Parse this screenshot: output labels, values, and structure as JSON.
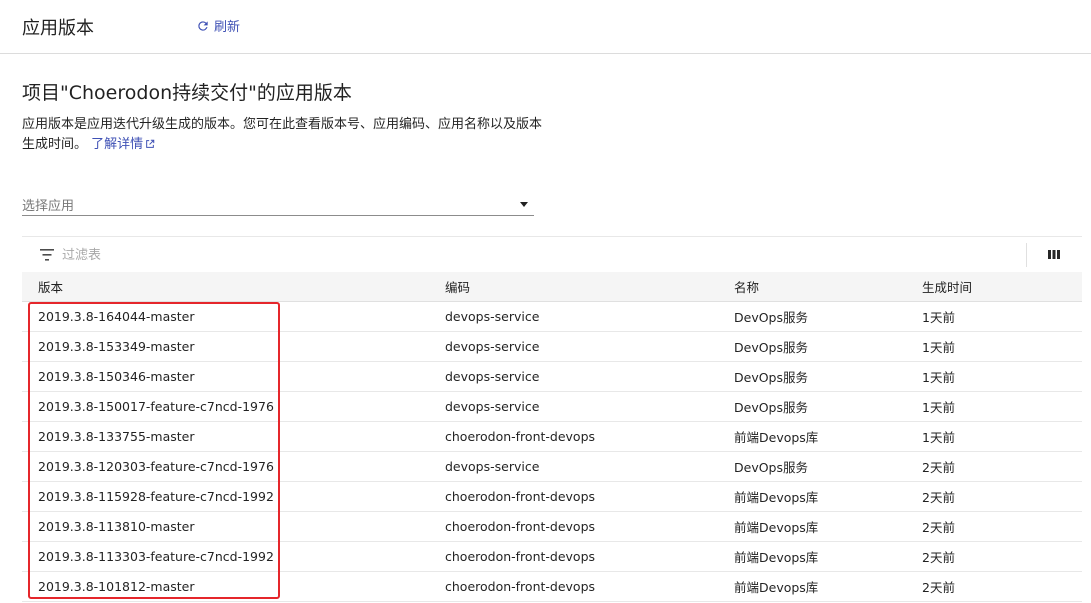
{
  "header": {
    "title": "应用版本",
    "refresh_label": "刷新"
  },
  "content": {
    "title": "项目\"Choerodon持续交付\"的应用版本",
    "description": "应用版本是应用迭代升级生成的版本。您可在此查看版本号、应用编码、应用名称以及版本生成时间。",
    "learn_more": "了解详情"
  },
  "select": {
    "placeholder": "选择应用"
  },
  "filter": {
    "placeholder": "过滤表"
  },
  "table": {
    "headers": {
      "version": "版本",
      "code": "编码",
      "name": "名称",
      "time": "生成时间"
    },
    "rows": [
      {
        "version": "2019.3.8-164044-master",
        "code": "devops-service",
        "name": "DevOps服务",
        "time": "1天前"
      },
      {
        "version": "2019.3.8-153349-master",
        "code": "devops-service",
        "name": "DevOps服务",
        "time": "1天前"
      },
      {
        "version": "2019.3.8-150346-master",
        "code": "devops-service",
        "name": "DevOps服务",
        "time": "1天前"
      },
      {
        "version": "2019.3.8-150017-feature-c7ncd-1976",
        "code": "devops-service",
        "name": "DevOps服务",
        "time": "1天前"
      },
      {
        "version": "2019.3.8-133755-master",
        "code": "choerodon-front-devops",
        "name": "前端Devops库",
        "time": "1天前"
      },
      {
        "version": "2019.3.8-120303-feature-c7ncd-1976",
        "code": "devops-service",
        "name": "DevOps服务",
        "time": "2天前"
      },
      {
        "version": "2019.3.8-115928-feature-c7ncd-1992",
        "code": "choerodon-front-devops",
        "name": "前端Devops库",
        "time": "2天前"
      },
      {
        "version": "2019.3.8-113810-master",
        "code": "choerodon-front-devops",
        "name": "前端Devops库",
        "time": "2天前"
      },
      {
        "version": "2019.3.8-113303-feature-c7ncd-1992",
        "code": "choerodon-front-devops",
        "name": "前端Devops库",
        "time": "2天前"
      },
      {
        "version": "2019.3.8-101812-master",
        "code": "choerodon-front-devops",
        "name": "前端Devops库",
        "time": "2天前"
      }
    ]
  },
  "colors": {
    "accent": "#3f51b5",
    "highlight": "#e5262b"
  }
}
